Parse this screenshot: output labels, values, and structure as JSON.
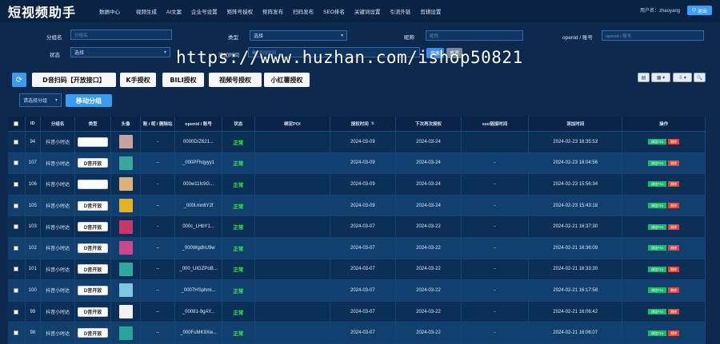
{
  "app": {
    "title": "短视频助手"
  },
  "nav": [
    "数据中心",
    "视频生成",
    "AI文案",
    "企业号设置",
    "矩阵号授权",
    "矩阵发布",
    "扫码发布",
    "SEO排名",
    "关键词设置",
    "引流外链",
    "剪辑设置"
  ],
  "user": {
    "label": "用户名：zhaoyang",
    "logout": "退出"
  },
  "filters": {
    "group_label": "分组名",
    "group_placeholder": "分组名",
    "type_label": "类型",
    "type_value": "选择",
    "nickname_label": "昵称",
    "nickname_placeholder": "昵称",
    "openid_label": "openid / 账号",
    "openid_placeholder": "openid / 账号",
    "status_label": "状态",
    "status_value": "选择",
    "time_label": "添加时间",
    "time_placeholder": "添加时间",
    "search": "搜索",
    "reset": "重置"
  },
  "watermark": "https://www.huzhan.com/ishop50821",
  "toolbar": {
    "auth_buttons": [
      "D音扫码【开放接口】",
      "K手授权",
      "BILI授权",
      "视频号授权",
      "小红薯授权"
    ],
    "group_select": "请选择分组",
    "move_group": "移动分组",
    "right_tools": [
      "▤",
      "▦ ▾",
      "⇩ ▾",
      "🔍"
    ]
  },
  "table": {
    "headers": [
      "ID",
      "分组名",
      "类型",
      "头像",
      "账 / 昵 / 删除站",
      "openid / 账号",
      "状态",
      "绑定POI",
      "授权时间",
      "下次再次授权",
      "seo链接时间",
      "添加时间",
      "操作"
    ],
    "rows": [
      {
        "id": "94",
        "group": "抖音小时达",
        "type": "",
        "avatar": "#c7a3a0",
        "acct": "-",
        "openid": "0000D/Z621...",
        "status": "正常",
        "poi": "",
        "auth": "2024-03-09",
        "next": "2024-03-24",
        "seo": "",
        "added": "2024-02-23 16:35:53"
      },
      {
        "id": "107",
        "group": "抖音小时达",
        "type": "D音开放",
        "avatar": "#39a7a0",
        "acct": "--",
        "openid": "_000PFhqyyy1",
        "status": "正常",
        "poi": "",
        "auth": "2024-03-09",
        "next": "2024-03-24",
        "seo": "-",
        "added": "2024-02-23 18:04:56"
      },
      {
        "id": "106",
        "group": "抖音小时达",
        "type": "",
        "avatar": "#d8b27a",
        "acct": "-",
        "openid": "000w11fc9G...",
        "status": "正常",
        "poi": "",
        "auth": "2024-03-09",
        "next": "2024-03-24",
        "seo": "-",
        "added": "2024-02-23 15:56:34"
      },
      {
        "id": "105",
        "group": "抖音小时达",
        "type": "D音开放",
        "avatar": "#e0b524",
        "acct": "--",
        "openid": "_000l.mn6Y2f",
        "status": "正常",
        "poi": "",
        "auth": "2024-03-09",
        "next": "2024-03-24",
        "seo": "-",
        "added": "2024-02-23 15:43:18"
      },
      {
        "id": "103",
        "group": "抖音小时达",
        "type": "D音开放",
        "avatar": "#c03a6e",
        "acct": "-",
        "openid": "000c_LHbY1...",
        "status": "正常",
        "poi": "",
        "auth": "2024-03-07",
        "next": "2024-03-22",
        "seo": "-",
        "added": "2024-02-21 16:37:30"
      },
      {
        "id": "102",
        "group": "抖音小时达",
        "type": "D音开放",
        "avatar": "#c84a8c",
        "acct": "--",
        "openid": "_000WgdhU9w",
        "status": "正常",
        "poi": "",
        "auth": "2024-03-07",
        "next": "2024-03-22",
        "seo": "-",
        "added": "2024-02-21 16:36:09"
      },
      {
        "id": "101",
        "group": "抖音小时达",
        "type": "D音开放",
        "avatar": "#2fa8a0",
        "acct": "--",
        "openid": "_000_UIGZPoB...",
        "status": "正常",
        "poi": "",
        "auth": "2024-03-07",
        "next": "2024-03-22",
        "seo": "-",
        "added": "2024-02-21 16:33:30"
      },
      {
        "id": "100",
        "group": "抖音小时达",
        "type": "D音开放",
        "avatar": "#7fc6e0",
        "acct": "--",
        "openid": "_0007HSphmi...",
        "status": "正常",
        "poi": "",
        "auth": "2024-03-07",
        "next": "2024-03-22",
        "seo": "-",
        "added": "2024-02-21 16:17:58"
      },
      {
        "id": "99",
        "group": "抖音小时达",
        "type": "D音开放",
        "avatar": "#f2f2f2",
        "acct": "--",
        "openid": "_00081-9gAY...",
        "status": "正常",
        "poi": "",
        "auth": "2024-03-07",
        "next": "2024-03-22",
        "seo": "-",
        "added": "2024-02-21 16:06:42"
      },
      {
        "id": "98",
        "group": "抖音小时达",
        "type": "D音开放",
        "avatar": "#27a49a",
        "acct": "--",
        "openid": "_000FuMK9Xw...",
        "status": "正常",
        "poi": "",
        "auth": "2024-03-07",
        "next": "2024-03-22",
        "seo": "-",
        "added": "2024-02-21 16:06:07"
      }
    ],
    "action_edit": "绑定POI",
    "action_delete": "删除"
  }
}
